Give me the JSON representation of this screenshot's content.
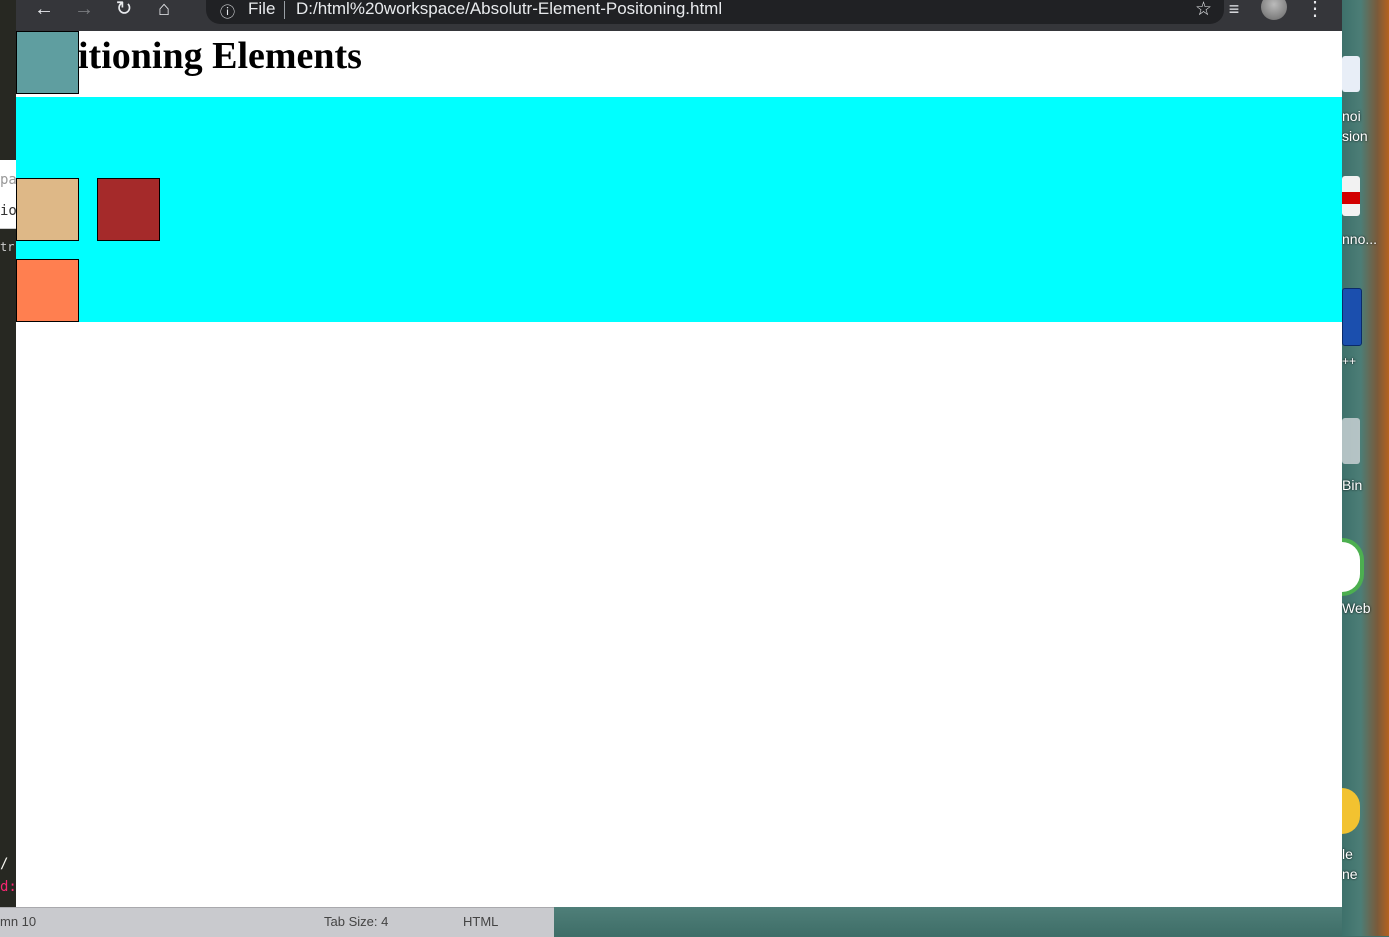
{
  "browser": {
    "omnibox_info_icon": "info-icon",
    "omnibox_scheme": "File",
    "url": "D:/html%20workspace/Absolutr-Element-Positoning.html",
    "buttons": [
      "back-arrow-icon",
      "forward-arrow-icon",
      "reload-icon",
      "home-icon"
    ],
    "right_icons": [
      "star-icon",
      "media-queue-icon",
      "profile-avatar",
      "kebab-menu-icon"
    ]
  },
  "page": {
    "heading": "itioning Elements",
    "colors": {
      "band": "#00ffff",
      "box_top": "#5f9ea0",
      "box_tan": "#deb887",
      "box_brown": "#a52a2a",
      "box_coral": "#ff7f50"
    }
  },
  "editor": {
    "status_column": "mn 10",
    "status_tab_size": "Tab Size: 4",
    "status_language": "HTML",
    "left_text_1": "pa",
    "left_text_2": "ior",
    "left_text_3": "tr-",
    "left_code_1": "/",
    "left_code_2": "d:"
  },
  "desktop": {
    "labels": [
      "noi",
      "sion",
      "nno...",
      "++",
      "Bin",
      "Web",
      "le",
      "ne"
    ]
  }
}
